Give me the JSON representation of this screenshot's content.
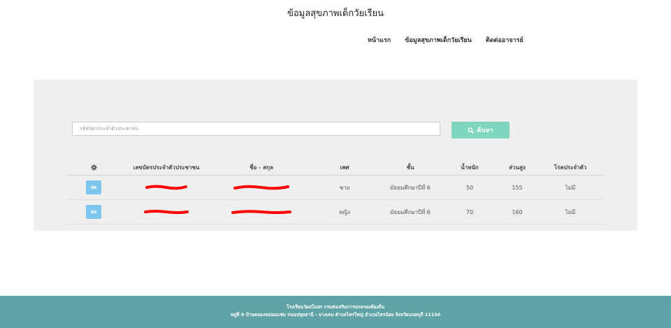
{
  "header": {
    "site_title": "ข้อมูลสุขภาพเด็กวัยเรียน"
  },
  "nav": {
    "home": "หน้าแรก",
    "health": "ข้อมูลสุขภาพเด็กวัยเรียน",
    "contact": "ติดต่ออาจารย์"
  },
  "search": {
    "placeholder": "รหัสบัตรประจำตัวประชาชน",
    "button_label": "ค้นหา"
  },
  "table": {
    "headers": {
      "action_icon": "gear-icon",
      "id_card": "เลขบัตรประจำตัวประชาชน",
      "name": "ชื่อ - สกุล",
      "gender": "เพศ",
      "grade": "ชั้น",
      "weight": "น้ำหนัก",
      "height": "ส่วนสูง",
      "disease": "โรคประจำตัว"
    },
    "rows": [
      {
        "gender": "ชาย",
        "grade": "มัธยมศึกษาปีที่ 6",
        "weight": "50",
        "height": "155",
        "disease": "ไม่มี"
      },
      {
        "gender": "หญิง",
        "grade": "มัธยมศึกษาปีที่ 6",
        "weight": "70",
        "height": "160",
        "disease": "ไม่มี"
      }
    ],
    "redaction_color": "#ff0000",
    "view_button_color": "#7cc6ef"
  },
  "footer": {
    "line1": "โรงเรียนวัดสโมสร กรมส่งเสริมการปกครองท้องถิ่น",
    "line2": "หมู่ที่ 9 บ้านคลองหม่อมแช่ม ถนนปทุมธานี - บางเลน ตำบลไทรใหญ่ อำเภอไทรน้อย จังหวัดนนทบุรี 11150"
  },
  "colors": {
    "panel": "#efefef",
    "search_button": "#7fd6be",
    "footer": "#5fa3a6"
  }
}
